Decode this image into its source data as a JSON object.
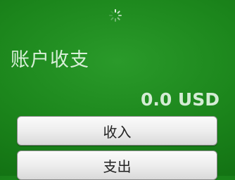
{
  "header": {
    "title": "账户收支"
  },
  "balance": {
    "amount_text": "0.0 USD"
  },
  "actions": {
    "income_label": "收入",
    "expense_label": "支出"
  },
  "status": {
    "loading_indicator": "spinner-icon"
  },
  "colors": {
    "background": "#1c861c",
    "title_text": "#d9f0d9",
    "button_bg": "#ececec"
  }
}
